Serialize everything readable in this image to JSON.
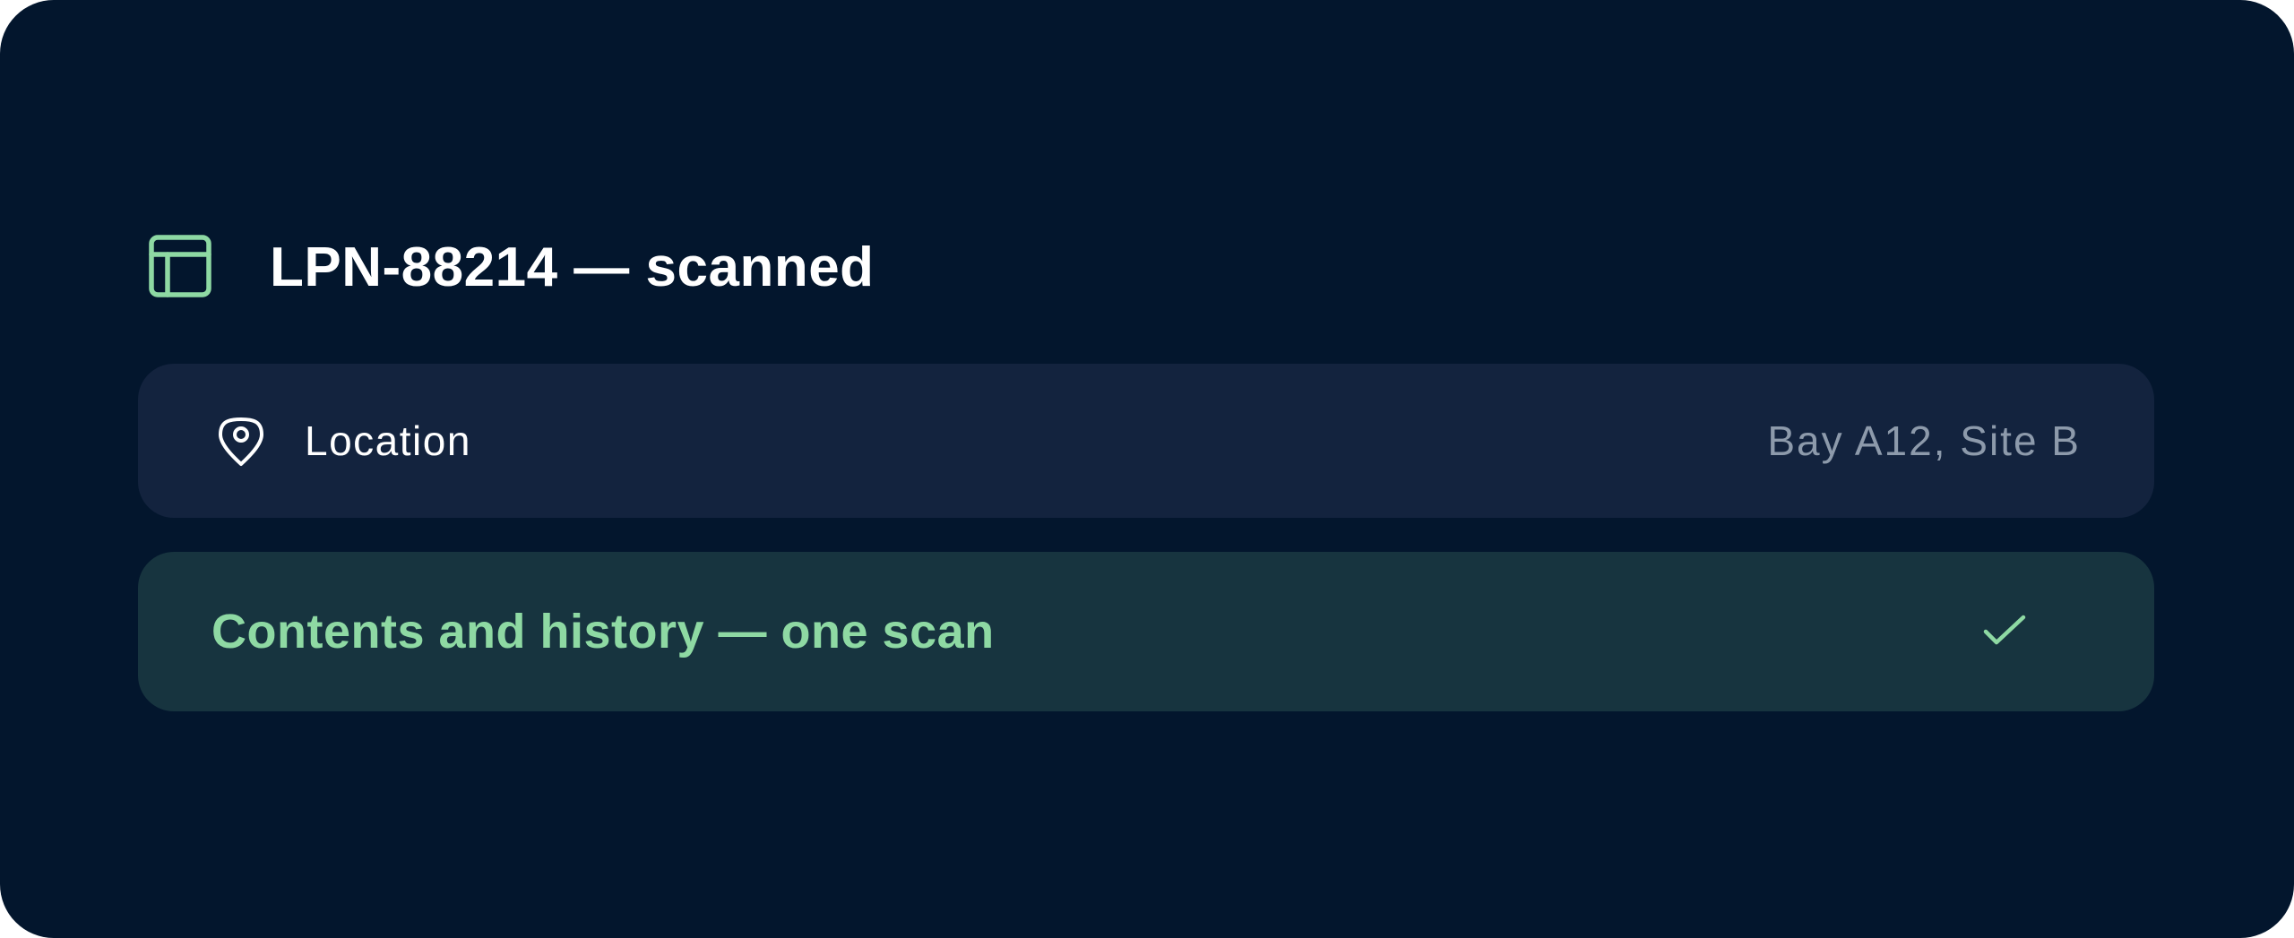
{
  "header": {
    "icon": "layout-icon",
    "title": "LPN-88214 — scanned"
  },
  "location_row": {
    "icon": "map-pin-icon",
    "label": "Location",
    "value": "Bay A12, Site B"
  },
  "contents_row": {
    "label": "Contents and history — one scan",
    "icon": "check-icon"
  },
  "colors": {
    "background": "#03162d",
    "location_row_bg": "#13233e",
    "contents_row_bg": "#17343f",
    "accent_green": "#8ed9a3",
    "muted_text": "#8d9aab",
    "primary_text": "#ffffff"
  }
}
